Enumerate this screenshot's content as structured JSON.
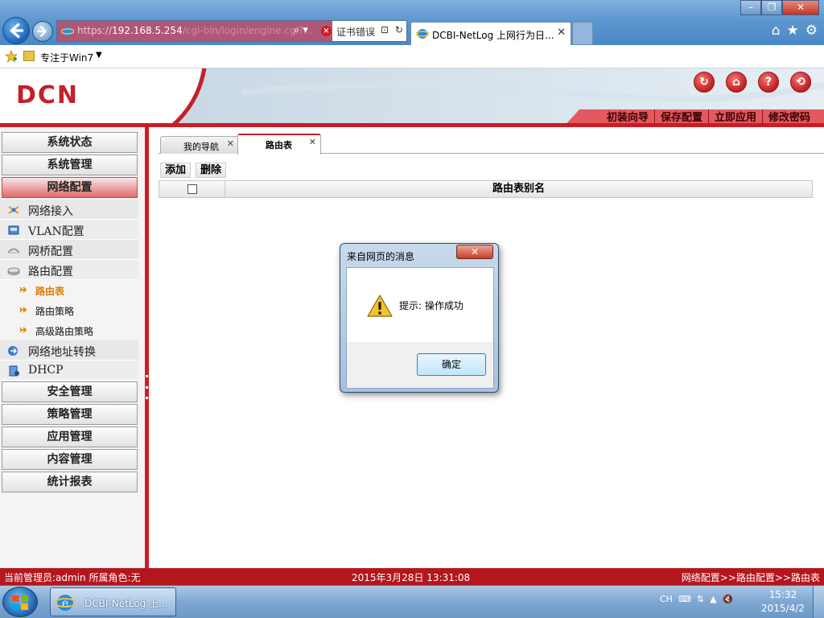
{
  "browser": {
    "url_protocol": "https://",
    "url_host": "192.168.5.254",
    "url_rest": "/cgi-bin/login/engine.cgi?...",
    "cert_error": "证书错误",
    "tab_title": "DCBI-NetLog 上网行为日...",
    "favorites_label": "专注于Win7"
  },
  "header": {
    "logo": "DCN",
    "menu": [
      "初装向导",
      "保存配置",
      "立即应用",
      "修改密码"
    ]
  },
  "sidebar": {
    "categories": [
      "系统状态",
      "系统管理",
      "网络配置",
      "安全管理",
      "策略管理",
      "应用管理",
      "内容管理",
      "统计报表"
    ],
    "subitems": [
      "网络接入",
      "VLAN配置",
      "网桥配置",
      "路由配置",
      "网络地址转换",
      "DHCP"
    ],
    "leaves": [
      "路由表",
      "路由策略",
      "高级路由策略"
    ]
  },
  "content": {
    "tabs": [
      "我的导航",
      "路由表"
    ],
    "toolbar": {
      "add": "添加",
      "delete": "删除"
    },
    "table_header": "路由表别名"
  },
  "dialog": {
    "title": "来自网页的消息",
    "message": "提示: 操作成功",
    "ok": "确定"
  },
  "status": {
    "admin": "当前管理员:admin   所属角色:无",
    "datetime": "2015年3月28日 13:31:08",
    "breadcrumb": "网络配置>>路由配置>>路由表"
  },
  "taskbar": {
    "task_label": "DCBI-NetLog 上...",
    "lang": "CH",
    "time": "15:32",
    "date": "2015/4/2"
  }
}
